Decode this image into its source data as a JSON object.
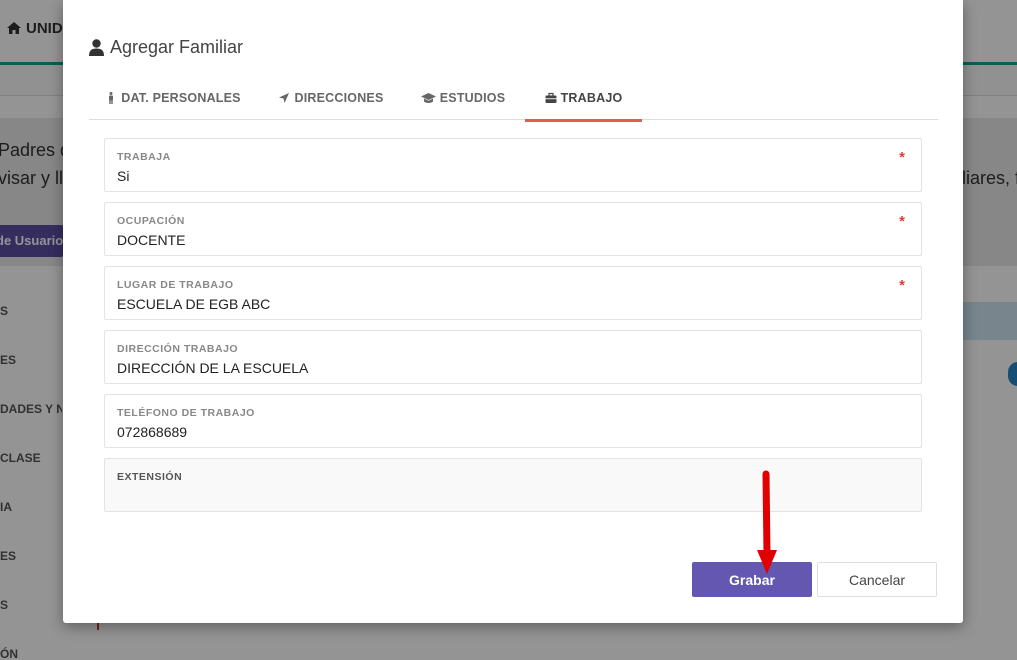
{
  "background": {
    "brand": "UNID",
    "banner_line1": "Padres de",
    "banner_line2": "visar y lle",
    "banner_right": "liares, f",
    "user_button": "de Usuario",
    "menu_items": [
      "S",
      "ES",
      "DADES Y N",
      "CLASE",
      "IA",
      "ES",
      "S",
      "ÓN"
    ]
  },
  "modal": {
    "title": "Agregar Familiar",
    "tabs": [
      {
        "label": "DAT. PERSONALES",
        "icon": "male-icon"
      },
      {
        "label": "DIRECCIONES",
        "icon": "location-arrow-icon"
      },
      {
        "label": "ESTUDIOS",
        "icon": "graduation-cap-icon"
      },
      {
        "label": "TRABAJO",
        "icon": "briefcase-icon",
        "active": true
      }
    ],
    "fields": [
      {
        "label": "TRABAJA",
        "value": "Si",
        "required": true
      },
      {
        "label": "OCUPACIÓN",
        "value": "DOCENTE",
        "required": true
      },
      {
        "label": "LUGAR DE TRABAJO",
        "value": "ESCUELA DE EGB ABC",
        "required": true
      },
      {
        "label": "DIRECCIÓN TRABAJO",
        "value": "DIRECCIÓN DE LA ESCUELA",
        "required": false
      },
      {
        "label": "TELÉFONO DE TRABAJO",
        "value": "072868689",
        "required": false
      },
      {
        "label": "EXTENSIÓN",
        "value": "",
        "required": false
      }
    ],
    "required_mark": "*",
    "save_label": "Grabar",
    "cancel_label": "Cancelar"
  },
  "colors": {
    "accent": "#6357b1",
    "active_tab_underline": "#e25c4f",
    "required": "#e23b3b",
    "header_line": "#13a391",
    "annotation_arrow": "#e00000"
  }
}
